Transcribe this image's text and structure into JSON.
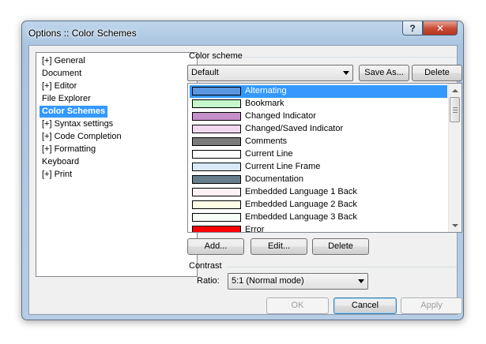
{
  "window": {
    "title": "Options :: Color Schemes",
    "help_label": "?",
    "close_label": "✕"
  },
  "tree": {
    "items": [
      {
        "label": "[+] General"
      },
      {
        "label": "Document"
      },
      {
        "label": "[+] Editor"
      },
      {
        "label": "File Explorer"
      },
      {
        "label": "Color Schemes",
        "selected": true
      },
      {
        "label": "[+] Syntax settings"
      },
      {
        "label": "[+] Code Completion"
      },
      {
        "label": "[+] Formatting"
      },
      {
        "label": "Keyboard"
      },
      {
        "label": "[+] Print"
      }
    ]
  },
  "color_scheme": {
    "group_label": "Color scheme",
    "selected_scheme": "Default",
    "save_as_label": "Save As...",
    "delete_label": "Delete"
  },
  "colors": {
    "items": [
      {
        "label": "Alternating",
        "color": "#5b96e0",
        "selected": true
      },
      {
        "label": "Bookmark",
        "color": "#c6f6cc"
      },
      {
        "label": "Changed Indicator",
        "color": "#c58fcb"
      },
      {
        "label": "Changed/Saved Indicator",
        "color": "#f4d8f0"
      },
      {
        "label": "Comments",
        "color": "#7a7a7a"
      },
      {
        "label": "Current Line",
        "color": "#ffffff"
      },
      {
        "label": "Current Line Frame",
        "color": "#d8e9fb"
      },
      {
        "label": "Documentation",
        "color": "#667e8b"
      },
      {
        "label": "Embedded Language 1 Back",
        "color": "#fff1f6"
      },
      {
        "label": "Embedded Language 2 Back",
        "color": "#fffde6"
      },
      {
        "label": "Embedded Language 3 Back",
        "color": "#f6fff8"
      },
      {
        "label": "Error",
        "color": "#ff0000"
      }
    ],
    "add_label": "Add...",
    "edit_label": "Edit...",
    "delete_label": "Delete"
  },
  "contrast": {
    "group_label": "Contrast",
    "ratio_label": "Ratio:",
    "ratio_value": "5:1 (Normal mode)"
  },
  "footer": {
    "ok_label": "OK",
    "cancel_label": "Cancel",
    "apply_label": "Apply"
  }
}
